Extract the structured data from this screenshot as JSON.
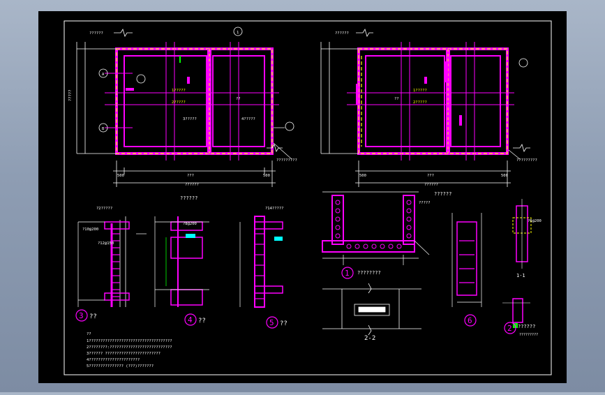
{
  "colors": {
    "background": "#000000",
    "frame": "#ffffff",
    "wall": "#ff00ff",
    "dash": "#ffff00",
    "text": "#ffffff",
    "annotation": "#ffff00",
    "accent_cyan": "#00ffff",
    "accent_green": "#00ff00"
  },
  "plan_left": {
    "title": "??????",
    "dim_total": "??????",
    "dim_left": "500",
    "dim_mid": "???",
    "dim_right": "500",
    "room_a": "??",
    "side_total": "?????",
    "axis_a": "A",
    "axis_b": "B",
    "axis_1": "1",
    "callout_bottom": "?????????",
    "label_a": "1?????",
    "label_b": "2?????",
    "label_c": "3?????",
    "label_d": "4?????"
  },
  "plan_right": {
    "title": "??????",
    "dim_total": "??????",
    "dim_left": "500",
    "dim_mid": "???",
    "dim_right": "500",
    "room_a": "??",
    "callout_bottom": "?????????",
    "label_a": "1?????",
    "label_b": "2?????"
  },
  "details": {
    "d3": {
      "num": "3",
      "title": "??"
    },
    "d4": {
      "num": "4",
      "title": "??",
      "top": "??????"
    },
    "d5": {
      "num": "5",
      "title": "??"
    },
    "d1": {
      "num": "1",
      "title": "????????"
    },
    "d6": {
      "num": "6"
    },
    "d2": {
      "num": "2",
      "title": "??????",
      "sub": "?????????"
    },
    "section22": {
      "title": "2-2"
    },
    "section11": {
      "title": "1-1"
    },
    "section_header": "??????"
  },
  "rebar_labels": [
    "?2?????",
    "?10@200",
    "?12@150",
    "?8@200",
    "?14?????",
    "?????",
    "?6@200"
  ],
  "notes": {
    "heading": "??",
    "lines": [
      "1????????????????????????????????????",
      "2????????:???????????????????????????",
      "3?????? ????????????????????????",
      "4??????????????????????",
      "5??????????????? (???)???????"
    ]
  }
}
